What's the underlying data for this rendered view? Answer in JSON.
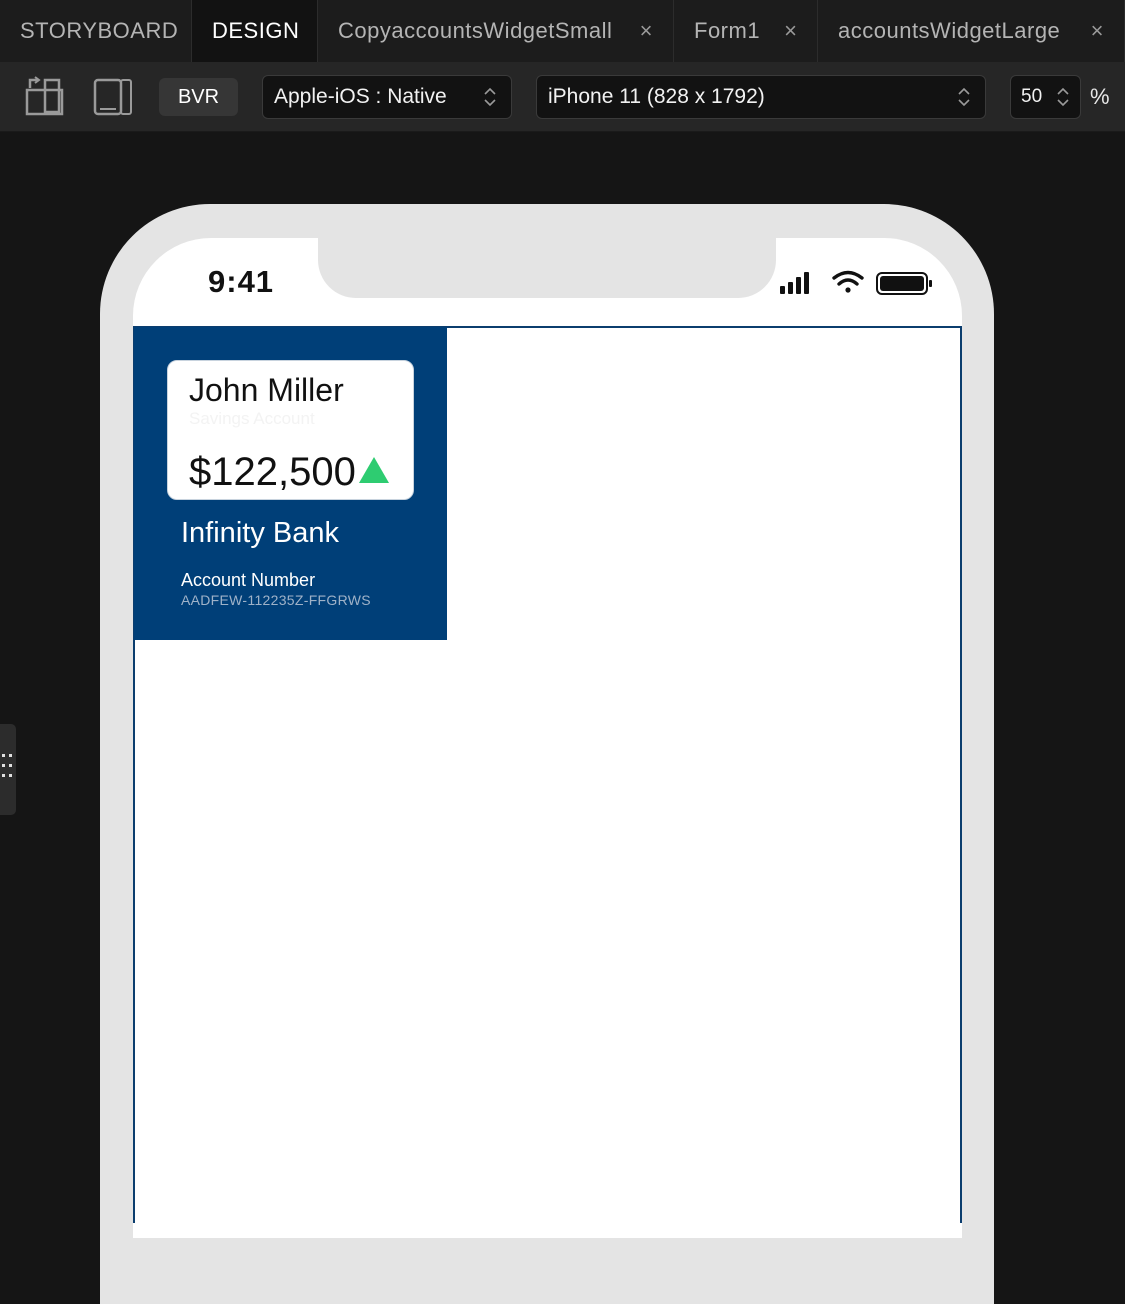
{
  "tabs": [
    {
      "label": "STORYBOARD",
      "active": false,
      "closable": false
    },
    {
      "label": "DESIGN",
      "active": true,
      "closable": false
    },
    {
      "label": "CopyaccountsWidgetSmall",
      "active": false,
      "closable": true
    },
    {
      "label": "Form1",
      "active": false,
      "closable": true
    },
    {
      "label": "accountsWidgetLarge",
      "active": false,
      "closable": true
    }
  ],
  "toolbar": {
    "bvr_label": "BVR",
    "platform": "Apple-iOS : Native",
    "device": "iPhone 11 (828 x 1792)",
    "zoom": "50",
    "zoom_unit": "%",
    "icons": [
      "rotate-orientation-icon",
      "device-frame-icon",
      "chevron-updown-icon"
    ]
  },
  "status_bar": {
    "time": "9:41",
    "icons": [
      "signal-icon",
      "wifi-icon",
      "battery-icon"
    ]
  },
  "widget": {
    "holder_name": "John Miller",
    "account_type": "Savings Account",
    "balance": "$122,500",
    "trend": "up",
    "bank_name": "Infinity Bank",
    "account_label": "Account Number",
    "account_number": "AADFEW-112235Z-FFGRWS"
  },
  "colors": {
    "widget_bg": "#003f78",
    "trend_up": "#2ecc71",
    "app_bg": "#151515"
  }
}
